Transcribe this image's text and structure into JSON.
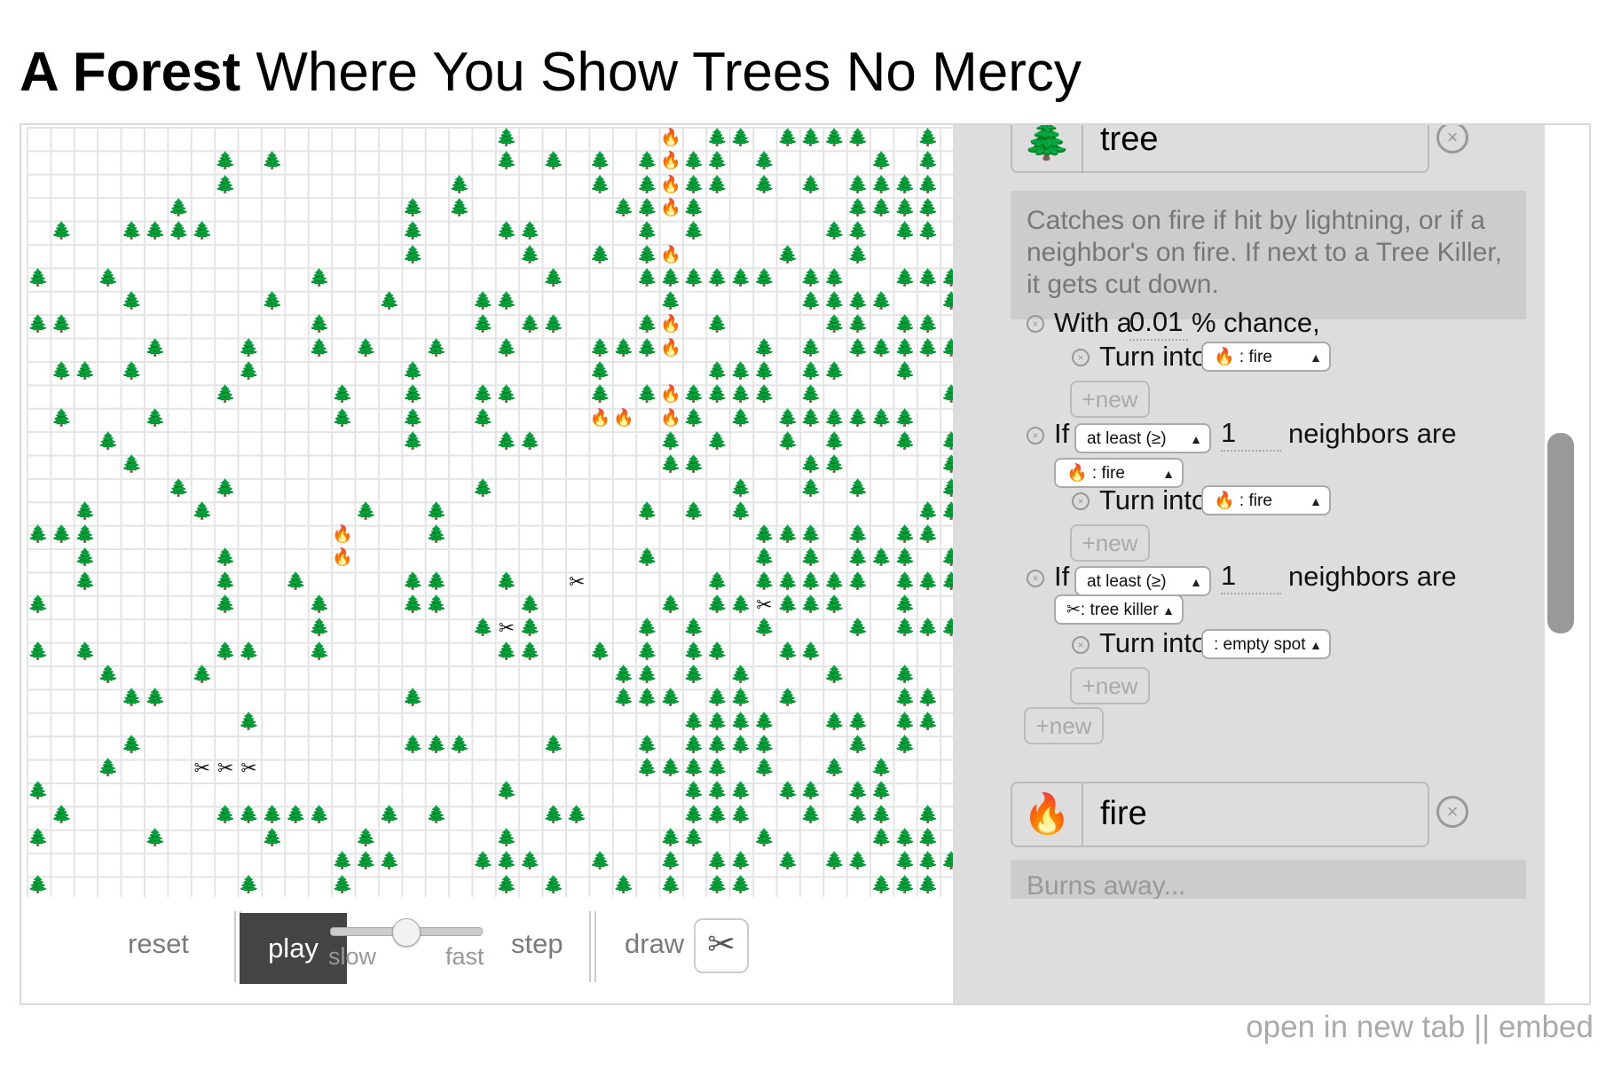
{
  "page": {
    "title_bold": "A Forest",
    "title_rest": " Where You Show Trees No Mercy"
  },
  "grid": {
    "cols": 40,
    "rows": 33,
    "glyphs": {
      "tree": "🌲",
      "fire": "🔥",
      "killer": "✂"
    },
    "fire_cells": [
      [
        27,
        0
      ],
      [
        27,
        1
      ],
      [
        27,
        2
      ],
      [
        27,
        3
      ],
      [
        27,
        5
      ],
      [
        27,
        8
      ],
      [
        27,
        9
      ],
      [
        27,
        11
      ],
      [
        24,
        12
      ],
      [
        25,
        12
      ],
      [
        27,
        12
      ],
      [
        13,
        17
      ],
      [
        13,
        18
      ]
    ],
    "killer_cells": [
      [
        23,
        19
      ],
      [
        31,
        20
      ],
      [
        20,
        21
      ],
      [
        7,
        27
      ],
      [
        8,
        27
      ],
      [
        9,
        27
      ]
    ]
  },
  "controls": {
    "reset": "reset",
    "play": "play",
    "slow": "slow",
    "fast": "fast",
    "step": "step",
    "draw": "draw",
    "speed_fraction": 0.5,
    "draw_tool_icon": "scissors-icon"
  },
  "panel": {
    "tree": {
      "icon": "🌲",
      "name": "tree",
      "description": "Catches on fire if hit by lightning, or if a neighbor's on fire. If next to a Tree Killer, it gets cut down.",
      "rule1": {
        "prefix": "With a",
        "chance": "0.01",
        "suffix": "% chance,",
        "turn_into_label": "Turn into",
        "turn_into_value": "🔥 : fire",
        "new_label": "+new"
      },
      "rule2": {
        "if_label": "If",
        "comparator": "at least (≥)",
        "count": "1",
        "neighbors_label": "neighbors are",
        "neighbor_type": "🔥 : fire",
        "turn_into_label": "Turn into",
        "turn_into_value": "🔥 : fire",
        "new_label": "+new"
      },
      "rule3": {
        "if_label": "If",
        "comparator": "at least (≥)",
        "count": "1",
        "neighbors_label": "neighbors are",
        "neighbor_type": "✂: tree killer",
        "turn_into_label": "Turn into",
        "turn_into_value": ": empty spot",
        "new_label": "+new"
      },
      "outer_new_label": "+new"
    },
    "fire": {
      "icon": "🔥",
      "name": "fire",
      "description_partial": "Burns away..."
    }
  },
  "footer": {
    "text": "open in new tab || embed"
  }
}
